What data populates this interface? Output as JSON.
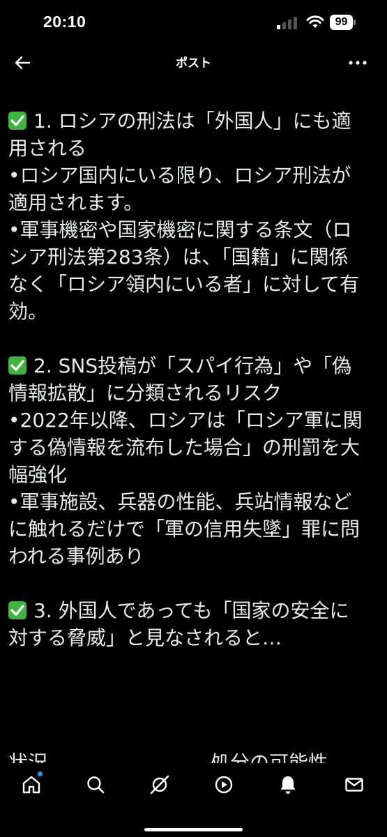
{
  "status_bar": {
    "time": "20:10",
    "battery": "99"
  },
  "header": {
    "title": "ポスト",
    "back_icon": "arrow-left-icon",
    "more_icon": "more-horizontal-icon"
  },
  "post": {
    "lines": [
      "1. ロシアの刑法は「外国人」にも適",
      "用される",
      "•ロシア国内にいる限り、ロシア刑法が",
      "適用されます。",
      "•軍事機密や国家機密に関する条文（ロ",
      "シア刑法第283条）は、「国籍」に関係",
      "なく「ロシア領内にいる者」に対して有",
      "効。",
      "",
      "2. SNS投稿が「スパイ行為」や「偽",
      "情報拡散」に分類されるリスク",
      "•2022年以降、ロシアは「ロシア軍に関",
      "する偽情報を流布した場合」の刑罰を大",
      "幅強化",
      "•軍事施設、兵器の性能、兵站情報など",
      "に触れるだけで「軍の信用失墜」罪に問",
      "われる事例あり",
      "",
      "3. 外国人であっても「国家の安全に",
      "対する脅威」と見なされると…",
      ""
    ],
    "table_peek": {
      "col1": "状況",
      "col2": "処分の可能性"
    }
  },
  "bottom_nav": {
    "items": [
      "home-icon",
      "search-icon",
      "grok-icon",
      "video-play-icon",
      "notifications-bell-icon",
      "messages-envelope-icon"
    ]
  },
  "colors": {
    "background": "#000000",
    "text": "#e7e9ea",
    "check": "#3fb43f",
    "accent": "#1d9bf0"
  }
}
